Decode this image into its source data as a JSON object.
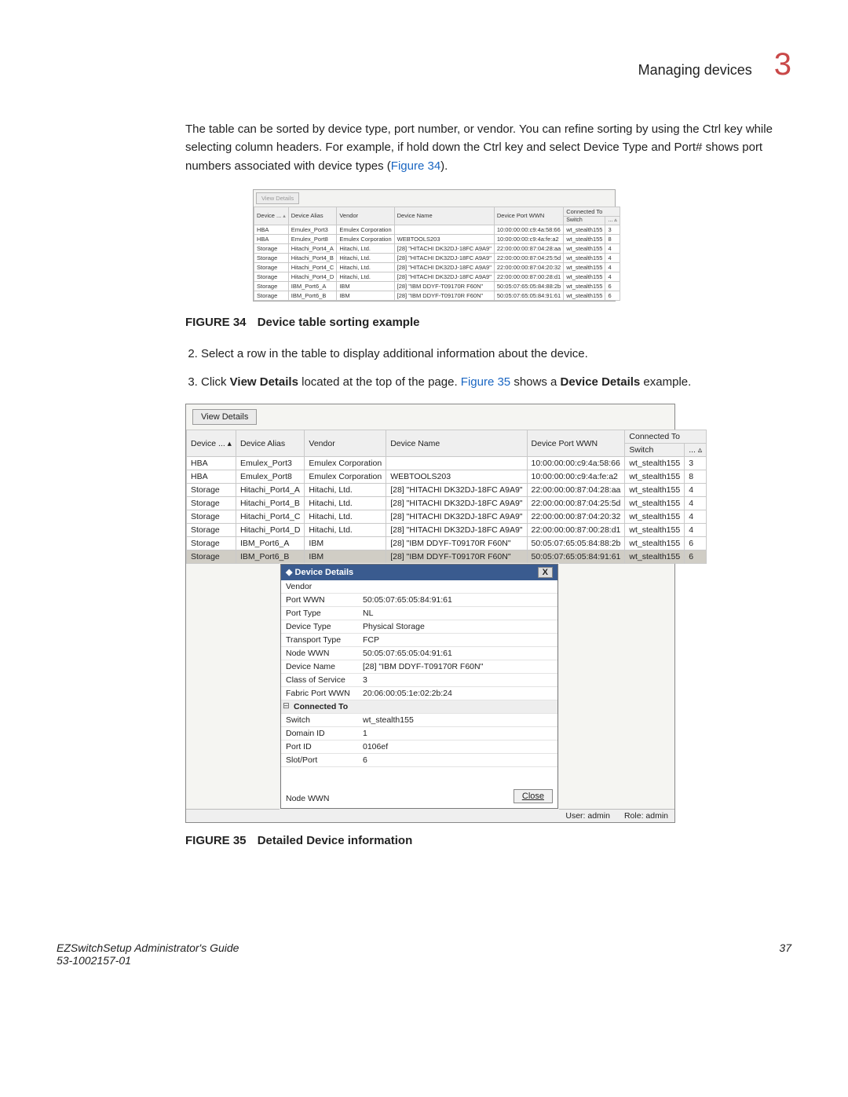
{
  "header": {
    "title": "Managing devices",
    "chapter": "3"
  },
  "intro": {
    "p1a": "The table can be sorted by device type, port number, or vendor. You can refine sorting by using the Ctrl key while selecting column headers. For example, if hold down the Ctrl key and select Device Type and Port# shows port numbers associated with device types (",
    "p1_link": "Figure 34",
    "p1b": ")."
  },
  "figure34": {
    "caption_label": "FIGURE 34",
    "caption_text": "Device table sorting example",
    "view_details": "View Details",
    "headers": {
      "device": "Device ...",
      "alias": "Device Alias",
      "vendor": "Vendor",
      "name": "Device Name",
      "wwn": "Device Port WWN",
      "connected": "Connected To",
      "switch": "Switch",
      "port": "...  ▵"
    },
    "rows": [
      {
        "d": "HBA",
        "a": "Emulex_Port3",
        "v": "Emulex Corporation",
        "n": "",
        "w": "10:00:00:00:c9:4a:58:66",
        "s": "wt_stealth155",
        "p": "3"
      },
      {
        "d": "HBA",
        "a": "Emulex_Port8",
        "v": "Emulex Corporation",
        "n": "WEBTOOLS203",
        "w": "10:00:00:00:c9:4a:fe:a2",
        "s": "wt_stealth155",
        "p": "8"
      },
      {
        "d": "Storage",
        "a": "Hitachi_Port4_A",
        "v": "Hitachi, Ltd.",
        "n": "[28] \"HITACHI DK32DJ-18FC    A9A9\"",
        "w": "22:00:00:00:87:04:28:aa",
        "s": "wt_stealth155",
        "p": "4"
      },
      {
        "d": "Storage",
        "a": "Hitachi_Port4_B",
        "v": "Hitachi, Ltd.",
        "n": "[28] \"HITACHI DK32DJ-18FC    A9A9\"",
        "w": "22:00:00:00:87:04:25:5d",
        "s": "wt_stealth155",
        "p": "4"
      },
      {
        "d": "Storage",
        "a": "Hitachi_Port4_C",
        "v": "Hitachi, Ltd.",
        "n": "[28] \"HITACHI DK32DJ-18FC    A9A9\"",
        "w": "22:00:00:00:87:04:20:32",
        "s": "wt_stealth155",
        "p": "4"
      },
      {
        "d": "Storage",
        "a": "Hitachi_Port4_D",
        "v": "Hitachi, Ltd.",
        "n": "[28] \"HITACHI DK32DJ-18FC    A9A9\"",
        "w": "22:00:00:00:87:00:28:d1",
        "s": "wt_stealth155",
        "p": "4"
      },
      {
        "d": "Storage",
        "a": "IBM_Port6_A",
        "v": "IBM",
        "n": "[28] \"IBM     DDYF-T09170R   F60N\"",
        "w": "50:05:07:65:05:84:88:2b",
        "s": "wt_stealth155",
        "p": "6"
      },
      {
        "d": "Storage",
        "a": "IBM_Port6_B",
        "v": "IBM",
        "n": "[28] \"IBM     DDYF-T09170R   F60N\"",
        "w": "50:05:07:65:05:84:91:61",
        "s": "wt_stealth155",
        "p": "6"
      }
    ]
  },
  "steps": {
    "s2": "Select a row in the table to display additional information about the device.",
    "s3a": "Click ",
    "s3b": "View Details",
    "s3c": " located at the top of the page. ",
    "s3_link": "Figure 35",
    "s3d": " shows a ",
    "s3e": "Device Details",
    "s3f": " example."
  },
  "figure35": {
    "caption_label": "FIGURE 35",
    "caption_text": "Detailed Device information",
    "view_details": "View Details",
    "headers": {
      "device": "Device ...   ▴",
      "alias": "Device Alias",
      "vendor": "Vendor",
      "name": "Device Name",
      "wwn": "Device Port WWN",
      "connected": "Connected To",
      "switch": "Switch",
      "port": "...  ▵"
    },
    "rows": [
      {
        "d": "HBA",
        "a": "Emulex_Port3",
        "v": "Emulex Corporation",
        "n": "",
        "w": "10:00:00:00:c9:4a:58:66",
        "s": "wt_stealth155",
        "p": "3",
        "sel": false
      },
      {
        "d": "HBA",
        "a": "Emulex_Port8",
        "v": "Emulex Corporation",
        "n": "WEBTOOLS203",
        "w": "10:00:00:00:c9:4a:fe:a2",
        "s": "wt_stealth155",
        "p": "8",
        "sel": false
      },
      {
        "d": "Storage",
        "a": "Hitachi_Port4_A",
        "v": "Hitachi, Ltd.",
        "n": "[28] \"HITACHI DK32DJ-18FC    A9A9\"",
        "w": "22:00:00:00:87:04:28:aa",
        "s": "wt_stealth155",
        "p": "4",
        "sel": false
      },
      {
        "d": "Storage",
        "a": "Hitachi_Port4_B",
        "v": "Hitachi, Ltd.",
        "n": "[28] \"HITACHI DK32DJ-18FC    A9A9\"",
        "w": "22:00:00:00:87:04:25:5d",
        "s": "wt_stealth155",
        "p": "4",
        "sel": false
      },
      {
        "d": "Storage",
        "a": "Hitachi_Port4_C",
        "v": "Hitachi, Ltd.",
        "n": "[28] \"HITACHI DK32DJ-18FC    A9A9\"",
        "w": "22:00:00:00:87:04:20:32",
        "s": "wt_stealth155",
        "p": "4",
        "sel": false
      },
      {
        "d": "Storage",
        "a": "Hitachi_Port4_D",
        "v": "Hitachi, Ltd.",
        "n": "[28] \"HITACHI DK32DJ-18FC    A9A9\"",
        "w": "22:00:00:00:87:00:28:d1",
        "s": "wt_stealth155",
        "p": "4",
        "sel": false
      },
      {
        "d": "Storage",
        "a": "IBM_Port6_A",
        "v": "IBM",
        "n": "[28] \"IBM     DDYF-T09170R   F60N\"",
        "w": "50:05:07:65:05:84:88:2b",
        "s": "wt_stealth155",
        "p": "6",
        "sel": false
      },
      {
        "d": "Storage",
        "a": "IBM_Port6_B",
        "v": "IBM",
        "n": "[28] \"IBM     DDYF-T09170R   F60N\"",
        "w": "50:05:07:65:05:84:91:61",
        "s": "wt_stealth155",
        "p": "6",
        "sel": true
      }
    ],
    "details": {
      "title": "Device Details",
      "close_x": "X",
      "rows1": [
        {
          "k": "Vendor",
          "v": ""
        },
        {
          "k": "Port WWN",
          "v": "50:05:07:65:05:84:91:61"
        },
        {
          "k": "Port Type",
          "v": "NL"
        },
        {
          "k": "Device Type",
          "v": "Physical Storage"
        },
        {
          "k": "Transport Type",
          "v": "FCP"
        },
        {
          "k": "Node WWN",
          "v": "50:05:07:65:05:04:91:61"
        },
        {
          "k": "Device Name",
          "v": "[28] \"IBM     DDYF-T09170R   F60N\""
        },
        {
          "k": "Class of Service",
          "v": "3"
        },
        {
          "k": "Fabric Port WWN",
          "v": "20:06:00:05:1e:02:2b:24"
        }
      ],
      "group": "Connected To",
      "rows2": [
        {
          "k": "Switch",
          "v": "wt_stealth155"
        },
        {
          "k": "Domain ID",
          "v": "1"
        },
        {
          "k": "Port ID",
          "v": "0106ef"
        },
        {
          "k": "Slot/Port",
          "v": "6"
        }
      ],
      "bottom_label": "Node WWN",
      "close_btn": "Close"
    },
    "status": {
      "user": "User: admin",
      "role": "Role: admin"
    }
  },
  "footer": {
    "left1": "EZSwitchSetup Administrator's Guide",
    "left2": "53-1002157-01",
    "right": "37"
  }
}
